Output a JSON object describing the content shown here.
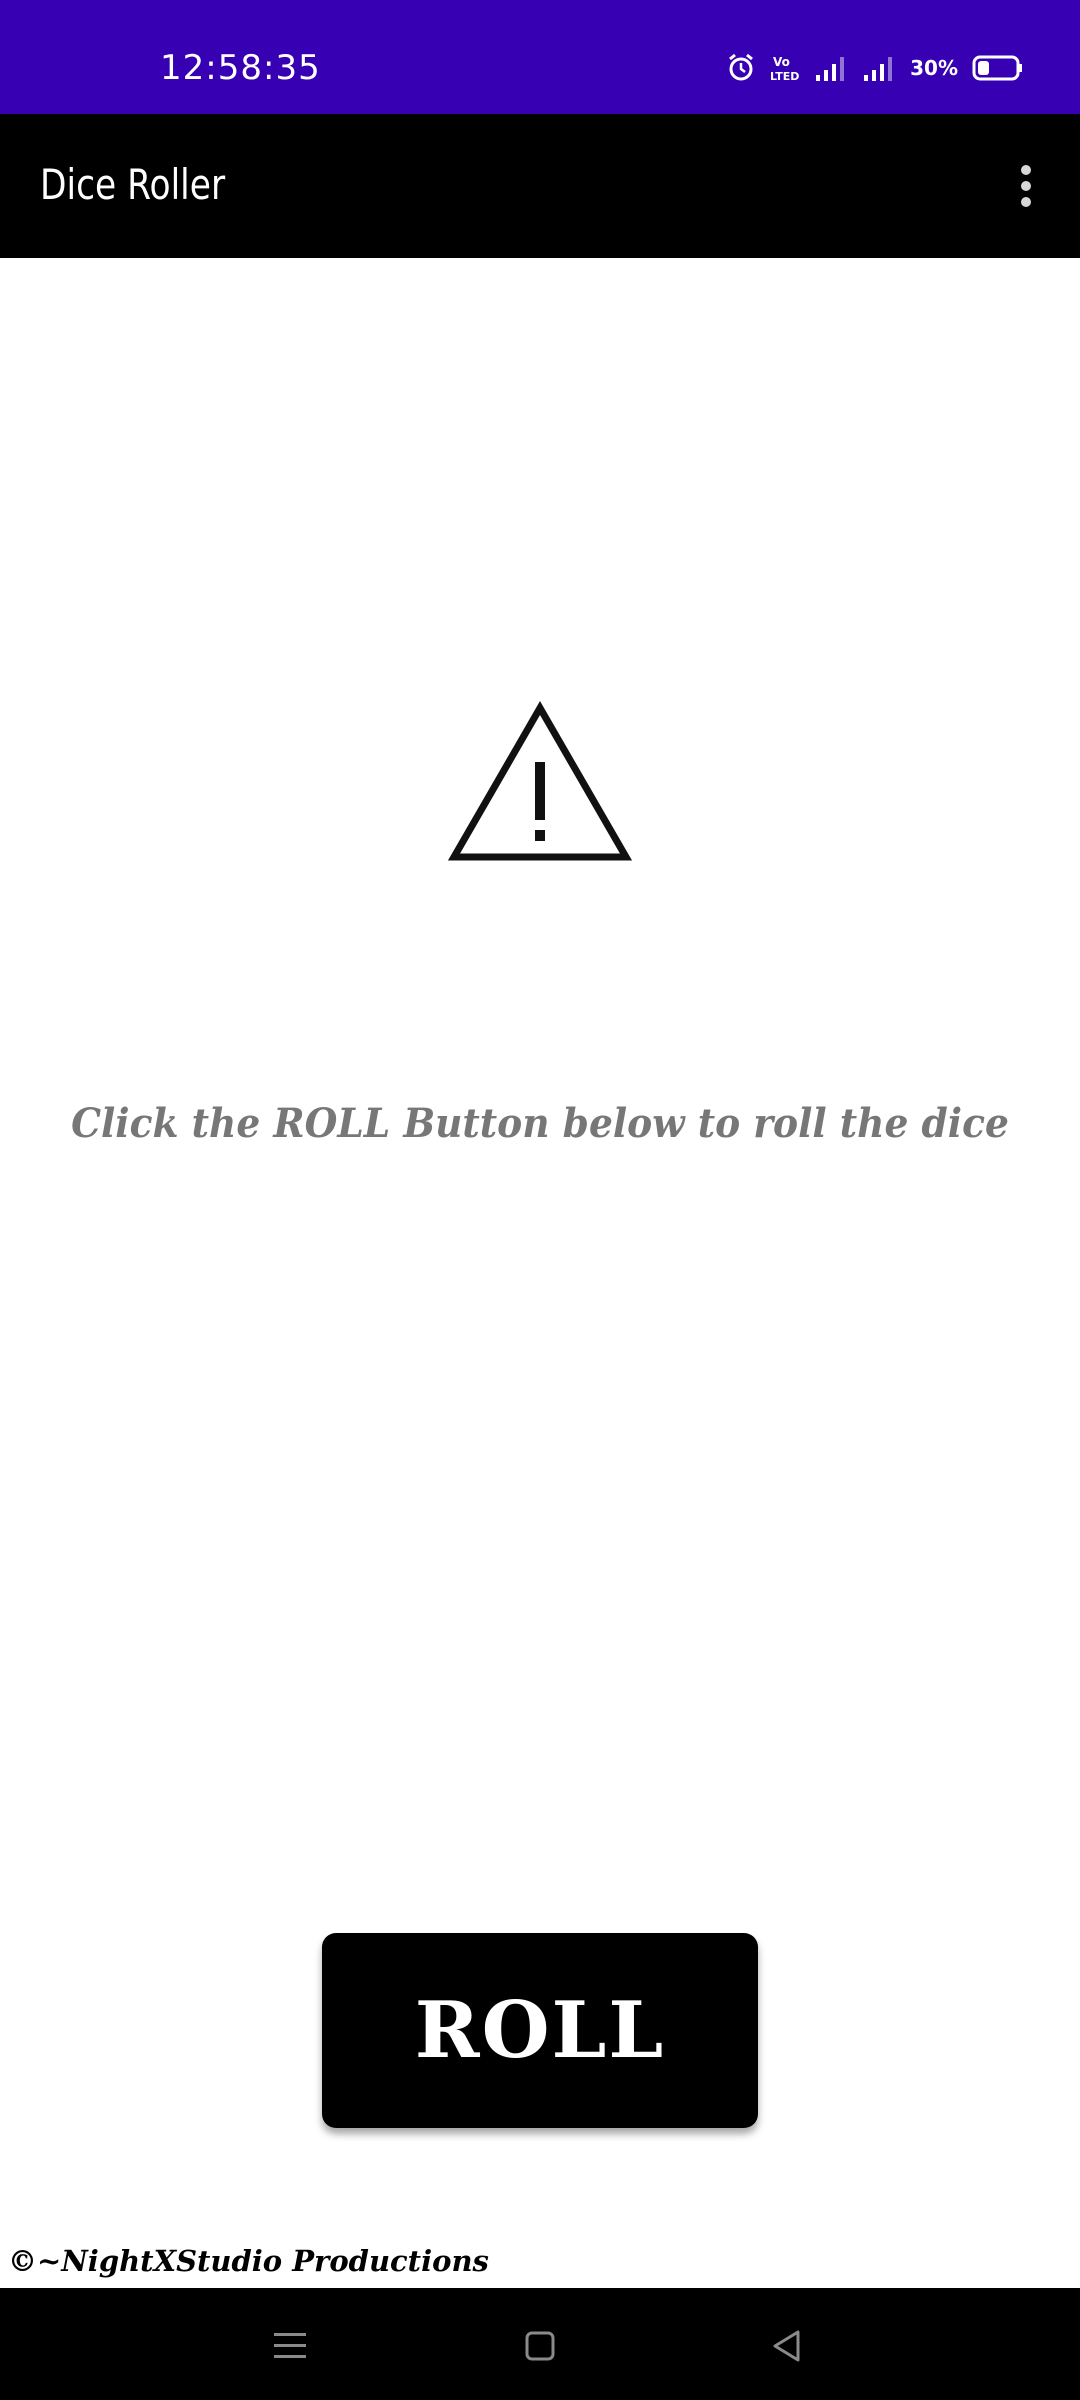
{
  "status_bar": {
    "time": "12:58:35",
    "battery_percent": "30%",
    "battery_level": 0.3,
    "icons": [
      "alarm-icon",
      "volte-icon",
      "signal-icon",
      "signal-icon",
      "battery-icon"
    ],
    "volte_label_top": "Vo",
    "volte_label_bottom": "LTED"
  },
  "app_bar": {
    "title": "Dice Roller",
    "overflow_icon": "more-vert-icon"
  },
  "main": {
    "image_icon": "warning-triangle-icon",
    "hint": "Click the ROLL Button below to roll the dice",
    "roll_label": "ROLL",
    "credit": "©~NightXStudio Productions"
  },
  "nav_bar": {
    "icons": [
      "recents-menu-icon",
      "home-square-icon",
      "back-triangle-icon"
    ]
  },
  "colors": {
    "status_bar": "#3700b3",
    "app_bar": "#000000",
    "button": "#000000",
    "hint_text": "#777777",
    "background": "#ffffff"
  }
}
